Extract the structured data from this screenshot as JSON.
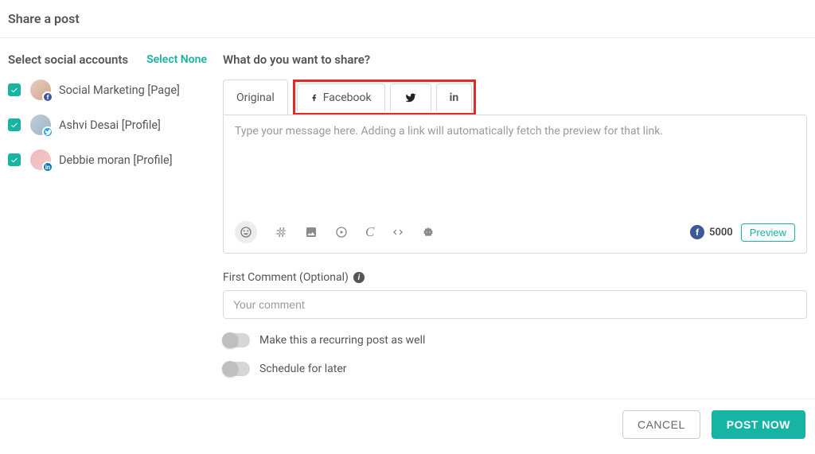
{
  "header": {
    "title": "Share a post"
  },
  "sidebar": {
    "title": "Select social accounts",
    "select_none": "Select None",
    "accounts": [
      {
        "name": "Social Marketing [Page]",
        "checked": true,
        "network": "facebook",
        "badge_letter": "f"
      },
      {
        "name": "Ashvi Desai [Profile]",
        "checked": true,
        "network": "twitter",
        "badge_letter": ""
      },
      {
        "name": "Debbie moran [Profile]",
        "checked": true,
        "network": "linkedin",
        "badge_letter": "in"
      }
    ]
  },
  "composer": {
    "heading": "What do you want to share?",
    "tabs": {
      "original": "Original",
      "facebook": "Facebook",
      "twitter": "",
      "linkedin": ""
    },
    "placeholder": "Type your message here. Adding a link will automatically fetch the preview for that link.",
    "char_limit": "5000",
    "preview_label": "Preview",
    "first_comment_label": "First Comment (Optional)",
    "first_comment_placeholder": "Your comment",
    "recurring_label": "Make this a recurring post as well",
    "schedule_label": "Schedule for later"
  },
  "footer": {
    "cancel": "CANCEL",
    "post_now": "POST NOW"
  }
}
